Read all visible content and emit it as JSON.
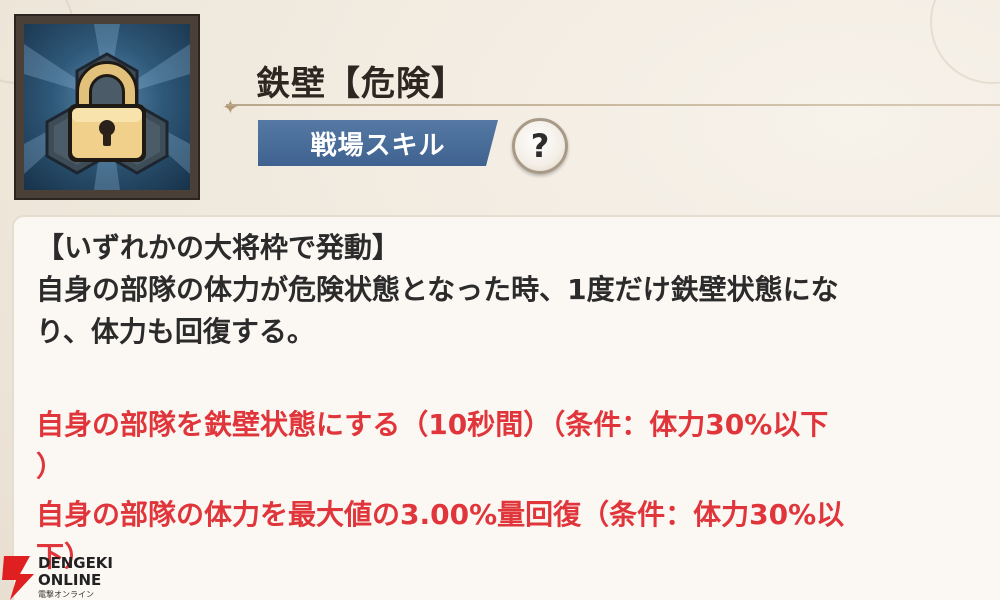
{
  "skill": {
    "icon": "lock-icon",
    "title": "鉄壁【危険】",
    "category_label": "戦場スキル",
    "help_label": "?"
  },
  "description": {
    "trigger": "【いずれかの大将枠で発動】",
    "body_line1": "自身の部隊の体力が危険状態となった時、1度だけ鉄壁状態にな",
    "body_line2": "り、体力も回復する。",
    "effect1_line1": "自身の部隊を鉄壁状態にする（10秒間）（条件：体力30%以下",
    "effect1_line2": "）",
    "effect2_line1": "自身の部隊の体力を最大値の3.00%量回復（条件：体力30%以",
    "effect2_line2": "下）"
  },
  "watermark": {
    "line1": "DENGEKI",
    "line2": "ONLINE",
    "line3": "電撃オンライン"
  },
  "colors": {
    "effect_text": "#e0353a",
    "badge": "#4a6d99",
    "body_text": "#2b2b2b"
  }
}
